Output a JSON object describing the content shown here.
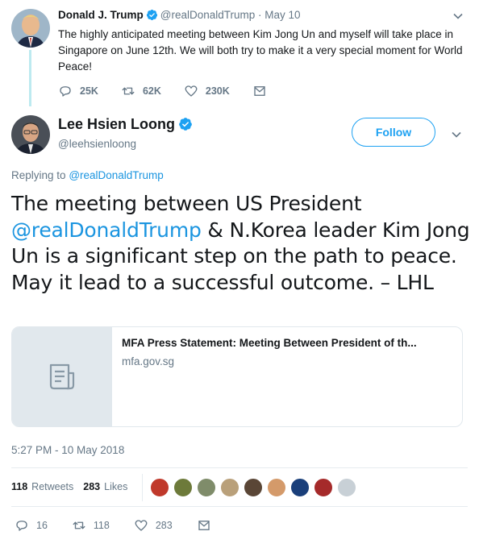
{
  "parent_tweet": {
    "name": "Donald J. Trump",
    "handle": "@realDonaldTrump",
    "date": "· May 10",
    "text": "The highly anticipated meeting between Kim Jong Un and myself will take place in Singapore on June 12th. We will both try to make it a very special moment for World Peace!",
    "replies": "25K",
    "retweets": "62K",
    "likes": "230K"
  },
  "main_tweet": {
    "name": "Lee Hsien Loong",
    "handle": "@leehsienloong",
    "follow_label": "Follow",
    "replying_prefix": "Replying to",
    "replying_to": "@realDonaldTrump",
    "text_part1": "The meeting between US President ",
    "text_mention": "@realDonaldTrump",
    "text_part2": " & N.Korea leader Kim Jong Un is a significant step on the path to peace. May it lead to a successful outcome. – LHL",
    "card_title": "MFA Press Statement: Meeting Between President of th...",
    "card_domain": "mfa.gov.sg",
    "timestamp": "5:27 PM - 10 May 2018",
    "retweet_count": "118",
    "retweet_label": "Retweets",
    "like_count": "283",
    "like_label": "Likes",
    "replies": "16",
    "retweets": "118",
    "likes": "283"
  },
  "liker_avatars": [
    "#c0392b",
    "#6d7a3a",
    "#7f8c6a",
    "#b9a07a",
    "#5a4636",
    "#d49a6a",
    "#1a3f7a",
    "#a52a2a",
    "#c8d0d6"
  ],
  "colors": {
    "accent": "#1da1f2",
    "link": "#1b95e0",
    "muted": "#657786",
    "thread": "#bdeaf0"
  }
}
